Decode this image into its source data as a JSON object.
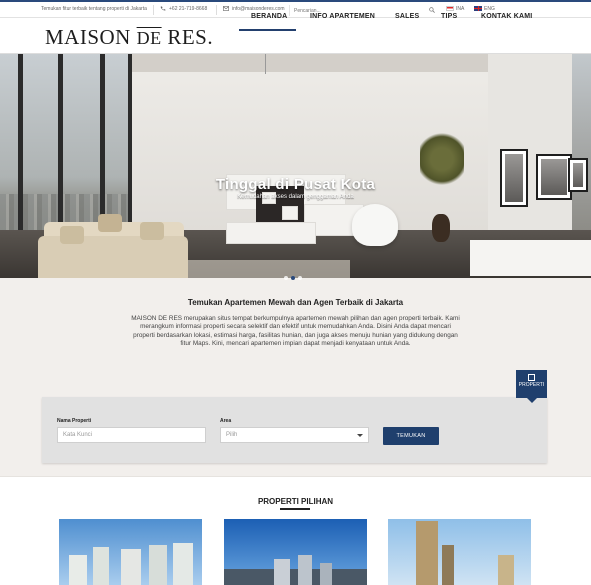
{
  "topbar": {
    "tagline": "Temukan fitur terbaik tentang properti di Jakarta",
    "phone": "+62 21-719-8668",
    "email": "info@maisonderes.com",
    "search_placeholder": "Pencarian...",
    "lang_id": "INA",
    "lang_en": "ENG"
  },
  "header": {
    "logo_part1": "MAISON",
    "logo_part2": "DE",
    "logo_part3": "RES.",
    "nav": [
      "BERANDA",
      "INFO APARTEMEN",
      "SALES",
      "TIPS",
      "KONTAK KAMI"
    ],
    "active_nav": "BERANDA"
  },
  "hero": {
    "title": "Tinggal di Pusat Kota",
    "subtitle": "Kemudahan akses dalam genggaman Anda",
    "slide_count": 3,
    "active_slide": 2
  },
  "intro": {
    "title": "Temukan Apartemen Mewah dan Agen Terbaik di Jakarta",
    "text": "MAISON DE RES merupakan situs tempat berkumpulnya apartemen mewah pilihan dan agen properti terbaik. Kami merangkum informasi properti secara selektif dan efektif untuk memudahkan Anda. Disini Anda dapat mencari properti berdasarkan lokasi, estimasi harga, fasilitas hunian, dan juga akses menuju hunian yang didukung dengan fitur Maps. Kini, mencari apartemen impian dapat menjadi kenyataan untuk Anda."
  },
  "search_panel": {
    "tab_label": "PROPERTI",
    "name_label": "Nama Properti",
    "name_placeholder": "Kata Kunci",
    "area_label": "Area",
    "area_selected": "Pilih",
    "button": "TEMUKAN"
  },
  "featured": {
    "title": "PROPERTI PILIHAN"
  },
  "colors": {
    "brand_navy": "#1f3f6d",
    "panel_gray": "#e1e1e1"
  }
}
